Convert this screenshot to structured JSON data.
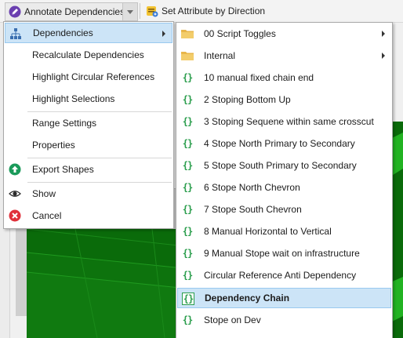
{
  "toolbar": {
    "annotate_label": "Annotate Dependencies",
    "set_attribute_label": "Set Attribute by Direction"
  },
  "main_menu": {
    "items": [
      {
        "label": "Dependencies",
        "icon": "hierarchy-icon",
        "submenu": true,
        "highlighted": true
      },
      {
        "label": "Recalculate Dependencies"
      },
      {
        "label": "Highlight Circular References"
      },
      {
        "label": "Highlight Selections"
      },
      {
        "label": "Range Settings"
      },
      {
        "label": "Properties"
      },
      {
        "label": "Export Shapes",
        "icon": "export-up-arrow-icon"
      },
      {
        "label": "Show",
        "icon": "eye-icon"
      },
      {
        "label": "Cancel",
        "icon": "cancel-x-icon"
      }
    ]
  },
  "sub_menu": {
    "items": [
      {
        "label": "00 Script Toggles",
        "icon": "folder-icon",
        "submenu": true
      },
      {
        "label": "Internal",
        "icon": "folder-icon",
        "submenu": true
      },
      {
        "label": "10 manual fixed chain end",
        "icon": "script-braces-icon"
      },
      {
        "label": "2 Stoping Bottom Up",
        "icon": "script-braces-icon"
      },
      {
        "label": "3 Stoping Sequene within same crosscut",
        "icon": "script-braces-icon"
      },
      {
        "label": "4 Stope North Primary to Secondary",
        "icon": "script-braces-icon"
      },
      {
        "label": "5 Stope South Primary to Secondary",
        "icon": "script-braces-icon"
      },
      {
        "label": "6 Stope North Chevron",
        "icon": "script-braces-icon"
      },
      {
        "label": "7 Stope South Chevron",
        "icon": "script-braces-icon"
      },
      {
        "label": "8 Manual Horizontal to Vertical",
        "icon": "script-braces-icon"
      },
      {
        "label": "9 Manual Stope wait on infrastructure",
        "icon": "script-braces-icon"
      },
      {
        "label": "Circular Reference Anti Dependency",
        "icon": "script-braces-icon"
      },
      {
        "label": "Dependency Chain",
        "icon": "script-braces-icon",
        "highlighted": true
      },
      {
        "label": "Stope on Dev",
        "icon": "script-braces-icon"
      }
    ]
  },
  "colors": {
    "menu_highlight": "#cce4f7",
    "menu_highlight_border": "#99c9ef",
    "script_icon": "#2a9d4c",
    "viewport_dark_green": "#0a6b0a",
    "viewport_light_green": "#22b322",
    "export_icon": "#1a9a5a",
    "cancel_icon": "#e0303a",
    "folder_icon": "#e8b64a"
  }
}
